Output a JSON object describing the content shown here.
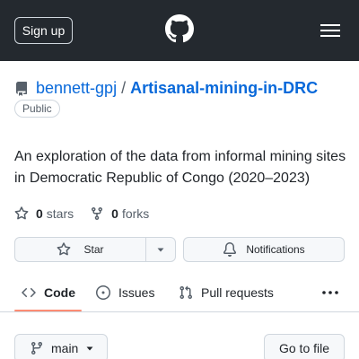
{
  "header": {
    "signup_label": "Sign up",
    "bg_color": "#24292f"
  },
  "repo": {
    "owner": "bennett-gpj",
    "separator": "/",
    "name": "Artisanal-mining-in-DRC",
    "visibility": "Public",
    "description": "An exploration of the data from informal mining sites in Democratic Republic of Congo (2020–2023)"
  },
  "stats": {
    "stars_count": "0",
    "stars_label": "stars",
    "forks_count": "0",
    "forks_label": "forks"
  },
  "actions": {
    "star_label": "Star",
    "notifications_label": "Notifications"
  },
  "tabs": [
    {
      "label": "Code",
      "icon": "code-icon",
      "active": true
    },
    {
      "label": "Issues",
      "icon": "issue-icon",
      "active": false
    },
    {
      "label": "Pull requests",
      "icon": "pull-request-icon",
      "active": false
    }
  ],
  "toolbar": {
    "branch_label": "main",
    "goto_file_label": "Go to file"
  },
  "colors": {
    "link": "#0969da",
    "active_tab_underline": "#fd8c73",
    "border": "#d0d7de"
  }
}
